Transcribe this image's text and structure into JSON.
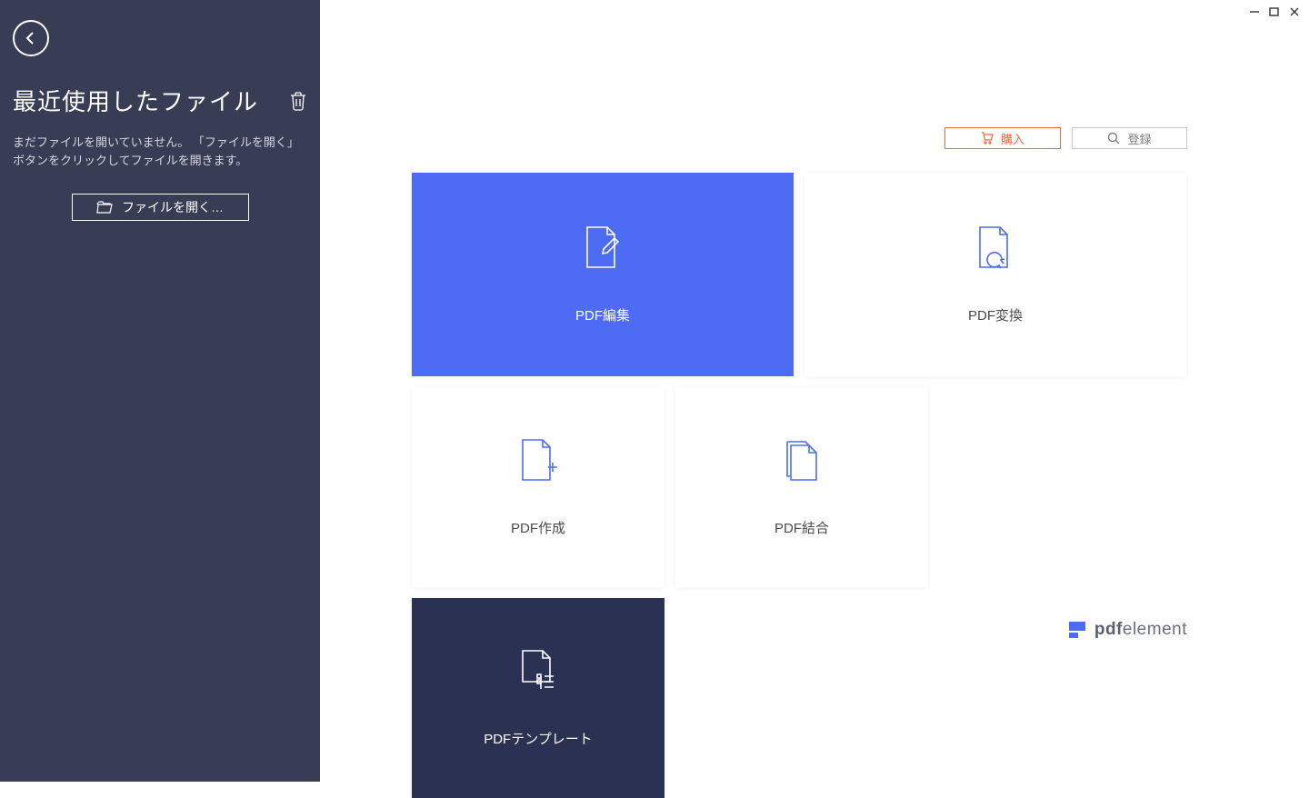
{
  "sidebar": {
    "title": "最近使用したファイル",
    "empty_message": "まだファイルを開いていません。 「ファイルを開く」ボタンをクリックしてファイルを開きます。",
    "open_button": "ファイルを開く…"
  },
  "topbar": {
    "buy": "購入",
    "register": "登録"
  },
  "tiles": {
    "edit": "PDF編集",
    "convert": "PDF変換",
    "create": "PDF作成",
    "combine": "PDF結合",
    "template": "PDFテンプレート"
  },
  "brand": {
    "bold": "pdf",
    "light": "element"
  },
  "colors": {
    "accent": "#4d6cf3",
    "sidebar": "#383c54",
    "dark_tile": "#2b3152",
    "orange": "#e86b3a"
  }
}
